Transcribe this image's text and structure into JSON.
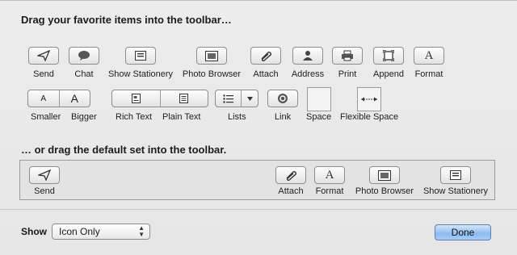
{
  "heading_favorites": "Drag your favorite items into the toolbar…",
  "heading_default": "… or drag the default set into the toolbar.",
  "items": {
    "send": "Send",
    "chat": "Chat",
    "show_stationery": "Show Stationery",
    "photo_browser": "Photo Browser",
    "attach": "Attach",
    "address": "Address",
    "print": "Print",
    "append": "Append",
    "format": "Format",
    "smaller": "Smaller",
    "bigger": "Bigger",
    "rich_text": "Rich Text",
    "plain_text": "Plain Text",
    "lists": "Lists",
    "link": "Link",
    "space": "Space",
    "flexible_space": "Flexible Space"
  },
  "default_set": {
    "send": "Send",
    "attach": "Attach",
    "format": "Format",
    "photo_browser": "Photo Browser",
    "show_stationery": "Show Stationery"
  },
  "footer": {
    "show_label": "Show",
    "show_value": "Icon Only",
    "done_label": "Done"
  },
  "colors": {
    "done_button": "#8cbaf0"
  }
}
